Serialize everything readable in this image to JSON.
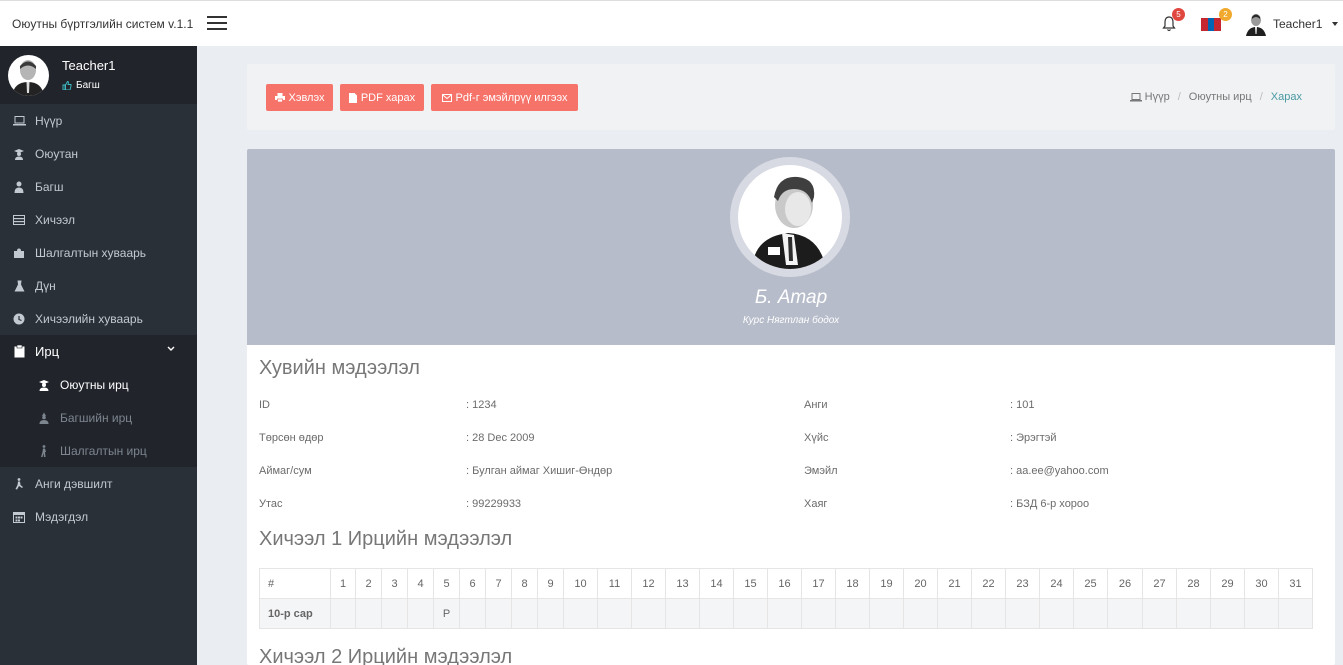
{
  "app": {
    "title": "Оюутны бүртгэлийн систем v.1.1"
  },
  "topbar": {
    "notification_count": "5",
    "language_count": "2",
    "flag_colors": [
      "#c4272f",
      "#0066b3",
      "#c4272f"
    ],
    "user_name": "Teacher1"
  },
  "sidebar": {
    "profile": {
      "name": "Teacher1",
      "role": "Багш"
    },
    "items": [
      {
        "label": "Нүүр",
        "icon": "laptop-icon"
      },
      {
        "label": "Оюутан",
        "icon": "student-icon"
      },
      {
        "label": "Багш",
        "icon": "teacher-icon"
      },
      {
        "label": "Хичээл",
        "icon": "book-icon"
      },
      {
        "label": "Шалгалтын хуваарь",
        "icon": "puzzle-icon"
      },
      {
        "label": "Дүн",
        "icon": "flask-icon"
      },
      {
        "label": "Хичээлийн хуваарь",
        "icon": "clock-icon"
      },
      {
        "label": "Ирц",
        "icon": "clipboard-icon"
      },
      {
        "label": "Оюутны ирц",
        "icon": "graduate-icon"
      },
      {
        "label": "Багшийн ирц",
        "icon": "teacher-icon"
      },
      {
        "label": "Шалгалтын ирц",
        "icon": "person-walking-icon"
      },
      {
        "label": "Анги дэвшилт",
        "icon": "stairs-icon"
      },
      {
        "label": "Мэдэгдэл",
        "icon": "calendar-icon"
      }
    ]
  },
  "toolbar": {
    "print_label": "Хэвлэх",
    "pdf_label": "PDF харах",
    "email_label": "Pdf-г эмэйлрүү илгээх"
  },
  "breadcrumb": {
    "home": "Нүүр",
    "section": "Оюутны ирц",
    "current": "Харах"
  },
  "student": {
    "name": "Б. Атар",
    "course": "Курс Нягтлан бодох"
  },
  "personal": {
    "title": "Хувийн мэдээлэл",
    "rows": [
      {
        "l1": "ID",
        "v1": ": 1234",
        "l2": "Анги",
        "v2": ": 101"
      },
      {
        "l1": "Төрсөн өдөр",
        "v1": ": 28 Dec 2009",
        "l2": "Хүйс",
        "v2": ": Эрэгтэй"
      },
      {
        "l1": "Аймаг/сум",
        "v1": ": Булган аймаг Хишиг-Өндөр",
        "l2": "Эмэйл",
        "v2": ": aa.ee@yahoo.com"
      },
      {
        "l1": "Утас",
        "v1": ": 99229933",
        "l2": "Хаяг",
        "v2": ": БЗД 6-р хороо"
      }
    ]
  },
  "lesson1": {
    "title": "Хичээл 1 Ирцийн мэдээлэл",
    "hash": "#",
    "days": [
      "1",
      "2",
      "3",
      "4",
      "5",
      "6",
      "7",
      "8",
      "9",
      "10",
      "11",
      "12",
      "13",
      "14",
      "15",
      "16",
      "17",
      "18",
      "19",
      "20",
      "21",
      "22",
      "23",
      "24",
      "25",
      "26",
      "27",
      "28",
      "29",
      "30",
      "31"
    ],
    "month": "10-р сар",
    "marks": [
      "",
      "",
      "",
      "",
      "P",
      "",
      "",
      "",
      "",
      "",
      "",
      "",
      "",
      "",
      "",
      "",
      "",
      "",
      "",
      "",
      "",
      "",
      "",
      "",
      "",
      "",
      "",
      "",
      "",
      "",
      ""
    ]
  },
  "lesson2": {
    "title": "Хичээл 2 Ирцийн мэдээлэл"
  }
}
